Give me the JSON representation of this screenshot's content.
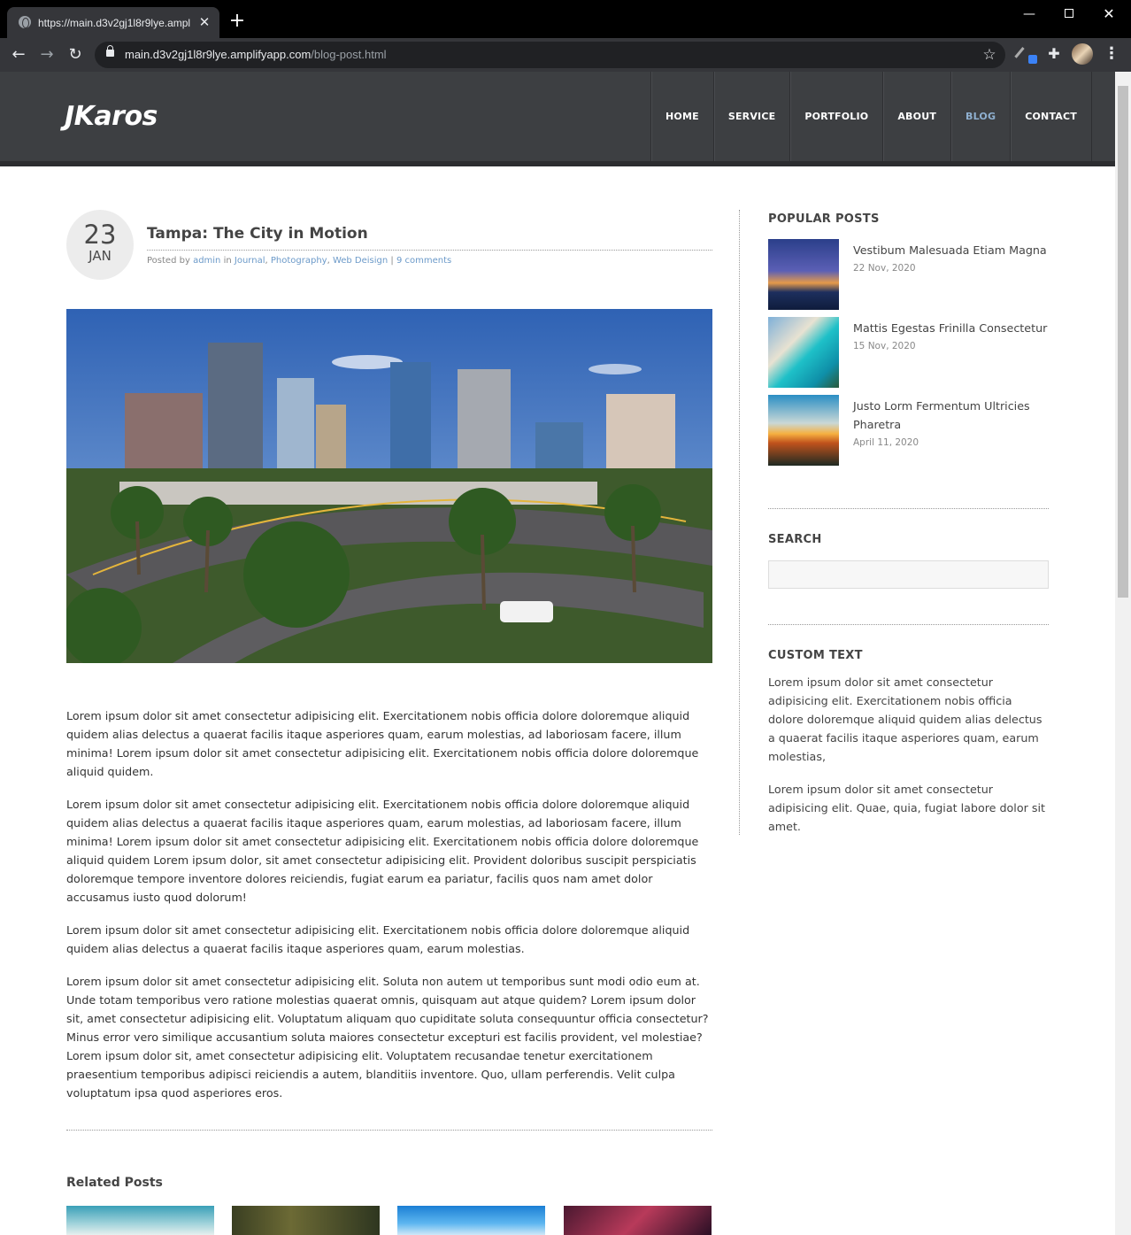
{
  "browser": {
    "tab_title": "https://main.d3v2gj1l8r9lye.ampl",
    "url_host": "main.d3v2gj1l8r9lye.amplifyapp.com",
    "url_path": "/blog-post.html"
  },
  "site": {
    "logo": "JKaros",
    "nav": [
      "HOME",
      "SERVICE",
      "PORTFOLIO",
      "ABOUT",
      "BLOG",
      "CONTACT"
    ],
    "active_nav": "BLOG",
    "accent_color": "#8fb0d0",
    "header_bg": "#3d3f42"
  },
  "post": {
    "day": "23",
    "month": "JAN",
    "title": "Tampa: The City in Motion",
    "meta_posted_by": "Posted by",
    "author": "admin",
    "meta_in": "in",
    "categories": [
      "Journal",
      "Photography",
      "Web Deisign"
    ],
    "comments": "9 comments",
    "paragraphs": [
      "Lorem ipsum dolor sit amet consectetur adipisicing elit. Exercitationem nobis officia dolore doloremque aliquid quidem alias delectus a quaerat facilis itaque asperiores quam, earum molestias, ad laboriosam facere, illum minima! Lorem ipsum dolor sit amet consectetur adipisicing elit. Exercitationem nobis officia dolore doloremque aliquid quidem.",
      "Lorem ipsum dolor sit amet consectetur adipisicing elit. Exercitationem nobis officia dolore doloremque aliquid quidem alias delectus a quaerat facilis itaque asperiores quam, earum molestias, ad laboriosam facere, illum minima! Lorem ipsum dolor sit amet consectetur adipisicing elit. Exercitationem nobis officia dolore doloremque aliquid quidem Lorem ipsum dolor, sit amet consectetur adipisicing elit. Provident doloribus suscipit perspiciatis doloremque tempore inventore dolores reiciendis, fugiat earum ea pariatur, facilis quos nam amet dolor accusamus iusto quod dolorum!",
      "Lorem ipsum dolor sit amet consectetur adipisicing elit. Exercitationem nobis officia dolore doloremque aliquid quidem alias delectus a quaerat facilis itaque asperiores quam, earum molestias.",
      "Lorem ipsum dolor sit amet consectetur adipisicing elit. Soluta non autem ut temporibus sunt modi odio eum at. Unde totam temporibus vero ratione molestias quaerat omnis, quisquam aut atque quidem? Lorem ipsum dolor sit, amet consectetur adipisicing elit. Voluptatum aliquam quo cupiditate soluta consequuntur officia consectetur? Minus error vero similique accusantium soluta maiores consectetur excepturi est facilis provident, vel molestiae? Lorem ipsum dolor sit, amet consectetur adipisicing elit. Voluptatem recusandae tenetur exercitationem praesentium temporibus adipisci reiciendis a autem, blanditiis inventore. Quo, ullam perferendis. Velit culpa voluptatum ipsa quod asperiores eros."
    ]
  },
  "related": {
    "title": "Related Posts"
  },
  "sidebar": {
    "popular_heading": "POPULAR POSTS",
    "popular": [
      {
        "title": "Vestibum Malesuada Etiam Magna",
        "date": "22 Nov, 2020"
      },
      {
        "title": "Mattis Egestas Frinilla Consectetur",
        "date": "15 Nov, 2020"
      },
      {
        "title": "Justo Lorm Fermentum Ultricies Pharetra",
        "date": "April 11, 2020"
      }
    ],
    "search_heading": "SEARCH",
    "search_value": "",
    "custom_heading": "CUSTOM TEXT",
    "custom_paragraphs": [
      "Lorem ipsum dolor sit amet consectetur adipisicing elit. Exercitationem nobis officia dolore doloremque aliquid quidem alias delectus a quaerat facilis itaque asperiores quam, earum molestias,",
      "Lorem ipsum dolor sit amet consectetur adipisicing elit. Quae, quia, fugiat labore dolor sit amet."
    ]
  }
}
